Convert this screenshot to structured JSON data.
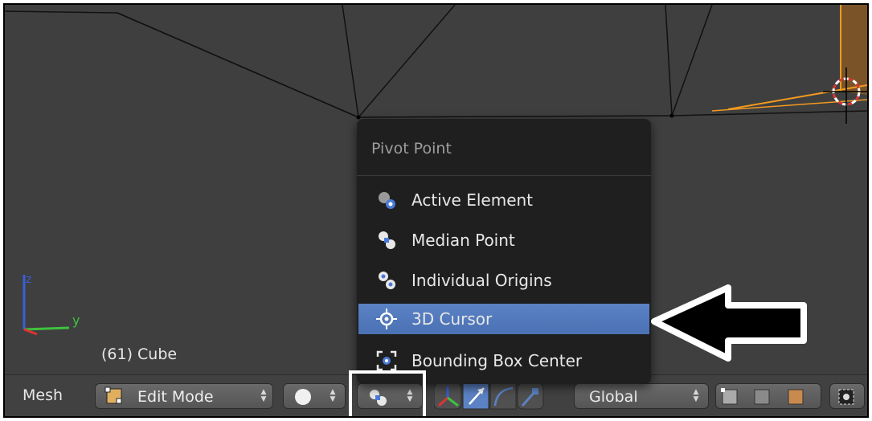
{
  "viewport": {
    "object_label": "(61) Cube",
    "axis_z": "z",
    "axis_y": "y"
  },
  "pivot_menu": {
    "title": "Pivot Point",
    "items": [
      {
        "label": "Active Element",
        "icon": "active-element-icon"
      },
      {
        "label": "Median Point",
        "icon": "median-point-icon"
      },
      {
        "label": "Individual Origins",
        "icon": "individual-origins-icon"
      },
      {
        "label": "3D Cursor",
        "icon": "3d-cursor-icon",
        "selected": true
      },
      {
        "label": "Bounding Box Center",
        "icon": "bounding-box-center-icon"
      }
    ]
  },
  "header": {
    "menu_mesh": "Mesh",
    "mode": "Edit Mode",
    "orientation": "Global"
  },
  "colors": {
    "selection": "#5b82c4",
    "highlight_box": "#ffffff",
    "orange_edge": "#f29a1f"
  }
}
